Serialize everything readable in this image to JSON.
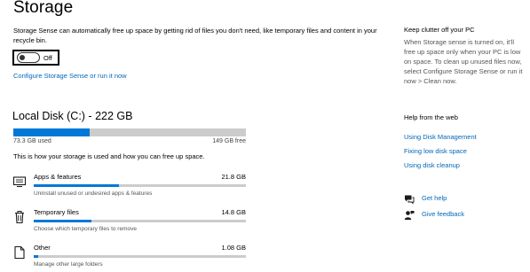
{
  "header": {
    "title": "Storage",
    "description": "Storage Sense can automatically free up space by getting rid of files you don't need, like temporary files and content in your recycle bin."
  },
  "storage_sense": {
    "toggle_state": "Off",
    "toggle_on": false,
    "configure_link": "Configure Storage Sense or run it now"
  },
  "disk": {
    "title": "Local Disk (C:) - 222 GB",
    "used": "73.3 GB used",
    "free": "149 GB free",
    "used_fraction": 0.33,
    "info": "This is how your storage is used and how you can free up space."
  },
  "categories": [
    {
      "name": "Apps & features",
      "size": "21.8 GB",
      "description": "Uninstall unused or undesired apps & features",
      "icon": "apps-monitor-icon",
      "fraction": 0.4
    },
    {
      "name": "Temporary files",
      "size": "14.8 GB",
      "description": "Choose which temporary files to remove",
      "icon": "trash-icon",
      "fraction": 0.27
    },
    {
      "name": "Other",
      "size": "1.08 GB",
      "description": "Manage other large folders",
      "icon": "folder-icon",
      "fraction": 0.02
    }
  ],
  "sidebar": {
    "clutter_heading": "Keep clutter off your PC",
    "clutter_text": "When Storage sense is turned on, it'll free up space only when your PC is low on space. To clean up unused files now, select Configure Storage Sense or run it now > Clean now.",
    "help_heading": "Help from the web",
    "links": [
      "Using Disk Management",
      "Fixing low disk space",
      "Using disk cleanup"
    ],
    "get_help": "Get help",
    "give_feedback": "Give feedback"
  },
  "colors": {
    "accent": "#0078d7",
    "link": "#0067b8",
    "bar_track": "#cccccc"
  }
}
